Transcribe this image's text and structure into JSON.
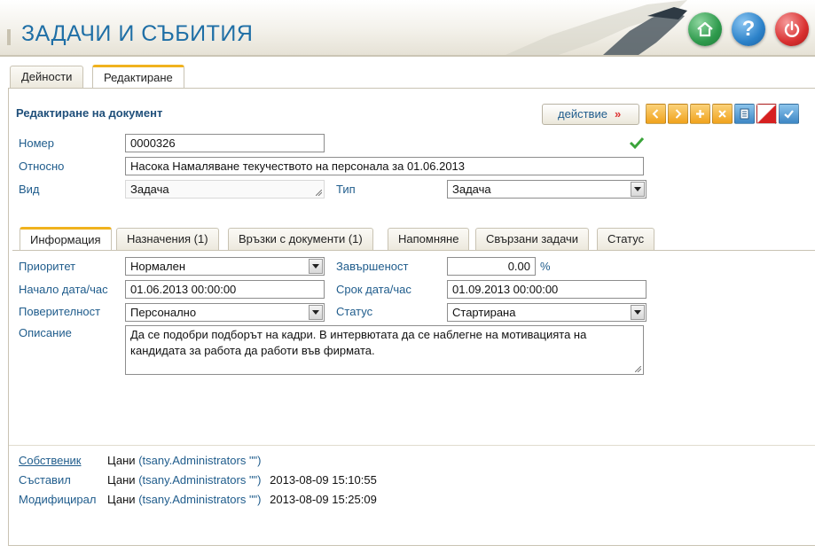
{
  "app": {
    "title": "ЗАДАЧИ И СЪБИТИЯ"
  },
  "header_buttons": {
    "home_icon": "home-icon",
    "help_icon": "help-icon",
    "help_glyph": "?",
    "power_icon": "power-icon"
  },
  "main_tabs": [
    "Дейности",
    "Редактиране"
  ],
  "document": {
    "title": "Редактиране на документ",
    "action_label": "действие",
    "action_arrow": "»"
  },
  "toolbar": [
    "chevron-left-icon",
    "chevron-right-icon",
    "add-icon",
    "delete-icon",
    "print-icon",
    "cancel-icon",
    "confirm-icon"
  ],
  "fields": {
    "number_label": "Номер",
    "number_value": "0000326",
    "subject_label": "Относно",
    "subject_value": "Насока Намаляване текучеството на персонала за 01.06.2013",
    "kind_label": "Вид",
    "kind_value": "Задача",
    "type_label": "Тип",
    "type_value": "Задача"
  },
  "inner_tabs": [
    "Информация",
    "Назначения (1)",
    "Връзки с документи (1)",
    "Напомняне",
    "Свързани задачи",
    "Статус"
  ],
  "info": {
    "priority_label": "Приоритет",
    "priority_value": "Нормален",
    "completion_label": "Завършеност",
    "completion_value": "0.00",
    "completion_unit": "%",
    "start_label": "Начало дата/час",
    "start_value": "01.06.2013 00:00:00",
    "deadline_label": "Срок дата/час",
    "deadline_value": "01.09.2013 00:00:00",
    "confidentiality_label": "Поверителност",
    "confidentiality_value": "Персонално",
    "status_label": "Статус",
    "status_value": "Стартирана",
    "description_label": "Описание",
    "description_value": "Да се подобри подборът на кадри. В интервютата да се наблегне на мотивацията на кандидата за работа да работи във фирмата."
  },
  "meta": {
    "owner_label": "Собственик",
    "owner_name": "Цани",
    "owner_user": "(tsany.Administrators \"\")",
    "created_label": "Съставил",
    "created_name": "Цани",
    "created_user": "(tsany.Administrators \"\")",
    "created_time": "2013-08-09 15:10:55",
    "modified_label": "Модифицирал",
    "modified_name": "Цани",
    "modified_user": "(tsany.Administrators \"\")",
    "modified_time": "2013-08-09 15:25:09"
  },
  "colors": {
    "accent": "#f0b21e",
    "title_blue": "#1f6fa6",
    "label_blue": "#1f5c8c"
  }
}
